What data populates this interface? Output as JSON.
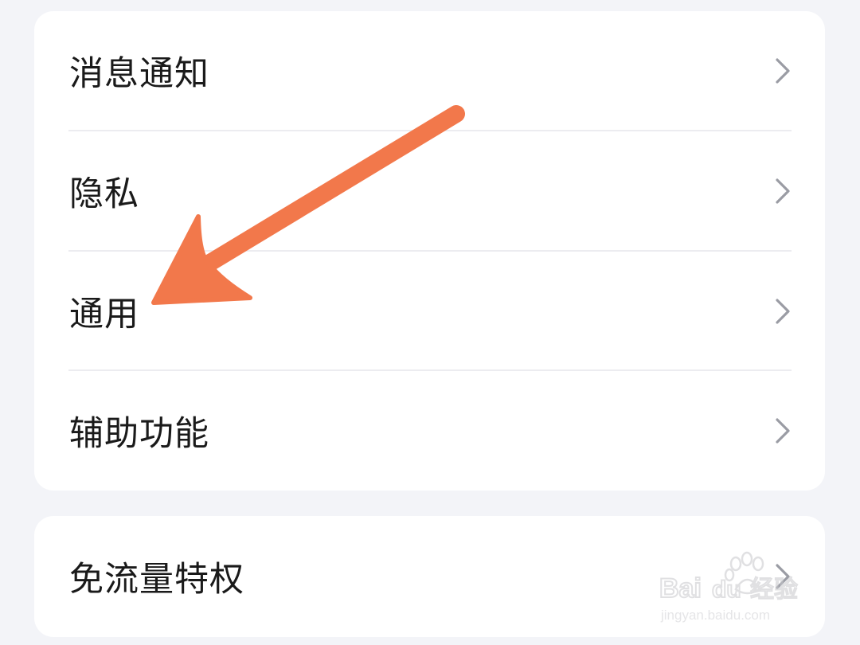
{
  "settings_group_1": {
    "items": [
      {
        "label": "消息通知"
      },
      {
        "label": "隐私"
      },
      {
        "label": "通用"
      },
      {
        "label": "辅助功能"
      }
    ]
  },
  "settings_group_2": {
    "items": [
      {
        "label": "免流量特权"
      }
    ]
  },
  "annotation": {
    "color": "#f2784b",
    "target": "通用"
  },
  "watermark": {
    "brand": "Baidu经验",
    "url": "jingyan.baidu.com"
  },
  "icons": {
    "row_chevron": "chevron-right-icon"
  }
}
